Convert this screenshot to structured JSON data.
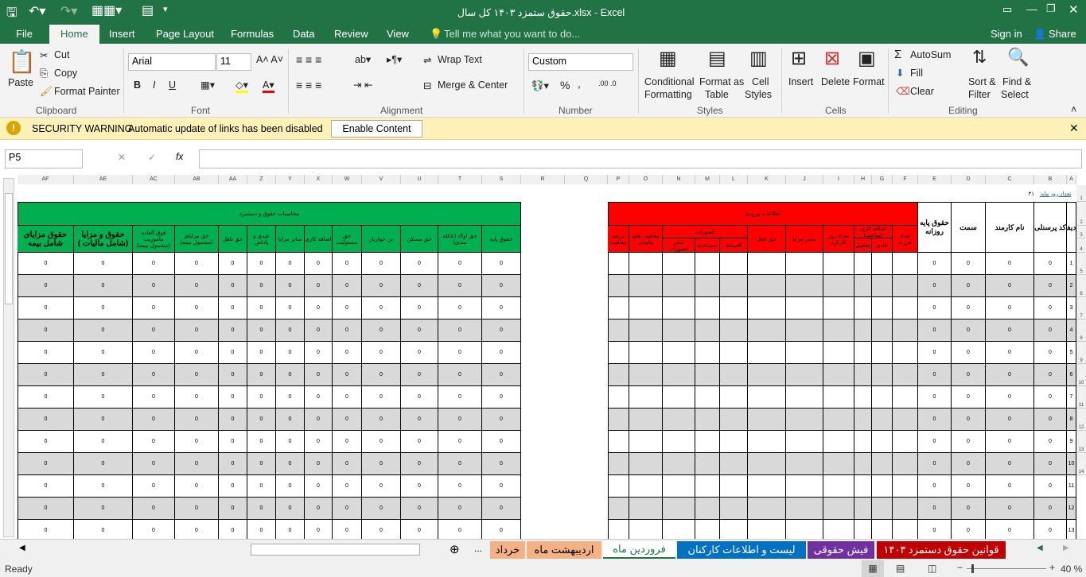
{
  "window": {
    "title": "حقوق  ستمزد ۱۴۰۳ کل سال.xlsx - Excel"
  },
  "menu": {
    "tabs": [
      "File",
      "Home",
      "Insert",
      "Page Layout",
      "Formulas",
      "Data",
      "Review",
      "View"
    ],
    "tell_me": "Tell me what you want to do...",
    "sign_in": "Sign in",
    "share": "Share"
  },
  "ribbon": {
    "clipboard": {
      "paste": "Paste",
      "cut": "Cut",
      "copy": "Copy",
      "format_painter": "Format Painter",
      "label": "Clipboard"
    },
    "font": {
      "name": "Arial",
      "size": "11",
      "bold": "B",
      "italic": "I",
      "underline": "U",
      "label": "Font"
    },
    "alignment": {
      "wrap": "Wrap Text",
      "merge": "Merge & Center",
      "label": "Alignment"
    },
    "number": {
      "format": "Custom",
      "percent": "%",
      "comma": ",",
      "label": "Number"
    },
    "styles": {
      "conditional": "Conditional",
      "conditional2": "Formatting",
      "format_table": "Format as",
      "format_table2": "Table",
      "cell_styles": "Cell",
      "cell_styles2": "Styles",
      "label": "Styles"
    },
    "cells": {
      "insert": "Insert",
      "delete": "Delete",
      "format": "Format",
      "label": "Cells"
    },
    "editing": {
      "autosum": "AutoSum",
      "fill": "Fill",
      "clear": "Clear",
      "sort": "Sort &",
      "sort2": "Filter",
      "find": "Find &",
      "find2": "Select",
      "label": "Editing"
    }
  },
  "warning": {
    "title": "SECURITY WARNING",
    "message": "Automatic update of links has been disabled",
    "button": "Enable Content"
  },
  "formula_bar": {
    "name_box": "P5",
    "fx": "fx",
    "value": ""
  },
  "sheet": {
    "days_label": "تعداد روز ماه:",
    "days_value": "۳۱",
    "green_title": "محاسبات حقوق و دستمزد",
    "red_title": "اطلاعات ورودی",
    "columns": [
      {
        "letter": "AF",
        "header": "حقوق مزایای شامل بیمه",
        "zone": "g"
      },
      {
        "letter": "AE",
        "header": "حقوق و مزایا (شامل مالیات )",
        "zone": "g"
      },
      {
        "letter": "AC",
        "header": "فوق العاده ماموریت (مشمول بیمه)",
        "zone": "g"
      },
      {
        "letter": "AB",
        "header": "حق مزایای (مشمول بیمه)",
        "zone": "g"
      },
      {
        "letter": "AA",
        "header": "حق تاهل",
        "zone": "g"
      },
      {
        "letter": "Z",
        "header": "عیدی و پاداش",
        "zone": "g"
      },
      {
        "letter": "Y",
        "header": "سایر مزایا",
        "zone": "g"
      },
      {
        "letter": "X",
        "header": "اضافه کاری",
        "zone": "g"
      },
      {
        "letter": "W",
        "header": "حق مسئولیت",
        "zone": "g"
      },
      {
        "letter": "V",
        "header": "بن خواربار",
        "zone": "g"
      },
      {
        "letter": "U",
        "header": "حق مسکن",
        "zone": "g"
      },
      {
        "letter": "T",
        "header": "حق اولاد (عائله مندی)",
        "zone": "g"
      },
      {
        "letter": "S",
        "header": "حقوق پایه",
        "zone": "g"
      },
      {
        "letter": "R",
        "header": "",
        "zone": "n"
      },
      {
        "letter": "Q",
        "header": "",
        "zone": "n"
      },
      {
        "letter": "P",
        "header": "درصد معافیت",
        "zone": "r"
      },
      {
        "letter": "O",
        "header": "معافیت های مالیاتی",
        "zone": "r"
      },
      {
        "letter": "N",
        "header": "سایر کسورات",
        "zone": "r"
      },
      {
        "letter": "M",
        "header": "مساعده",
        "zone": "r"
      },
      {
        "letter": "L",
        "header": "اقساط",
        "zone": "r"
      },
      {
        "letter": "K",
        "header": "حق تاهل",
        "zone": "r"
      },
      {
        "letter": "J",
        "header": "سایر مزایا",
        "zone": "r"
      },
      {
        "letter": "I",
        "header": "تعداد روز کارکرد",
        "zone": "r"
      },
      {
        "letter": "H",
        "header": "تعطیل",
        "zone": "r"
      },
      {
        "letter": "G",
        "header": "عادی",
        "zone": "r"
      },
      {
        "letter": "F",
        "header": "تعداد فرزند",
        "zone": "r"
      },
      {
        "letter": "E",
        "header": "حقوق پایه روزانه",
        "zone": "w"
      },
      {
        "letter": "D",
        "header": "سمت",
        "zone": "w"
      },
      {
        "letter": "C",
        "header": "نام کارمند",
        "zone": "w"
      },
      {
        "letter": "B",
        "header": "کد پرسنلی",
        "zone": "w"
      },
      {
        "letter": "A",
        "header": "ردیف",
        "zone": "w"
      }
    ],
    "red_subgroups": {
      "deductions": "کسورات",
      "overtime": "اضافه کاری (ساعت)"
    },
    "cell_value": "0",
    "row_numbers": [
      "1",
      "2",
      "3",
      "4",
      "5",
      "6",
      "7",
      "8",
      "9",
      "10",
      "11",
      "12",
      "13"
    ],
    "sheet_rows": [
      "1",
      "2",
      "3",
      "4",
      "5",
      "6",
      "7",
      "8",
      "9",
      "10",
      "11",
      "12",
      "13",
      "14"
    ]
  },
  "sheet_tabs": [
    {
      "label": "قوانین حقوق دستمزد ۱۴۰۳",
      "color": "#c00000"
    },
    {
      "label": "فیش حقوقی",
      "color": "#7030a0"
    },
    {
      "label": "لیست و اطلاعات  کارکنان",
      "color": "#0070c0"
    },
    {
      "label": "فروردین ماه",
      "color": "#ffffff",
      "active": true
    },
    {
      "label": "اردیبهشت ماه",
      "color": "#f4b183"
    },
    {
      "label": "خرداد",
      "color": "#f4b183"
    }
  ],
  "more_tabs": "...",
  "status": {
    "ready": "Ready",
    "zoom": "40 %"
  }
}
